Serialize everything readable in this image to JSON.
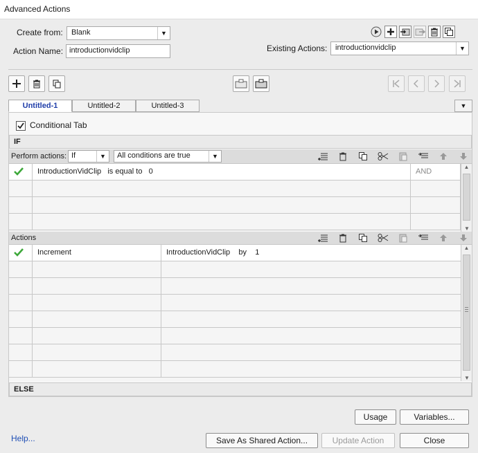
{
  "window": {
    "title": "Advanced Actions"
  },
  "top": {
    "create_from_label": "Create from:",
    "create_from_value": "Blank",
    "action_name_label": "Action Name:",
    "action_name_value": "introductionvidclip",
    "existing_actions_label": "Existing Actions:",
    "existing_actions_value": "introductionvidclip"
  },
  "tabs": [
    {
      "label": "Untitled-1"
    },
    {
      "label": "Untitled-2"
    },
    {
      "label": "Untitled-3"
    }
  ],
  "conditional": {
    "label": "Conditional Tab",
    "checked": true
  },
  "if_section": {
    "header": "IF",
    "perform_label": "Perform actions:",
    "perform_value": "If",
    "condition_mode": "All conditions are true",
    "rows": [
      {
        "variable": "IntroductionVidClip",
        "operator": "is equal to",
        "value": "0",
        "logic": "AND"
      }
    ]
  },
  "actions_section": {
    "header": "Actions",
    "rows": [
      {
        "action": "Increment",
        "target": "IntroductionVidClip",
        "op": "by",
        "amount": "1"
      }
    ]
  },
  "else_section": {
    "header": "ELSE"
  },
  "buttons": {
    "usage": "Usage",
    "variables": "Variables...",
    "help": "Help...",
    "save_shared": "Save As Shared Action...",
    "update": "Update Action",
    "close": "Close"
  },
  "colors": {
    "check_green": "#3da83a",
    "active_tab_text": "#1f3da8",
    "link_blue": "#1f4fb5"
  },
  "icons": [
    "preview-icon",
    "add-action-icon",
    "import-icon",
    "export-icon",
    "delete-icon",
    "duplicate-icon",
    "plus-icon",
    "trash-icon",
    "copy-icon",
    "tab-save-icon",
    "tab-open-icon",
    "first-icon",
    "prev-icon",
    "next-icon",
    "last-icon",
    "insert-row-icon",
    "cut-icon",
    "paste-icon",
    "up-arrow-icon",
    "down-arrow-icon",
    "checkmark-icon"
  ]
}
